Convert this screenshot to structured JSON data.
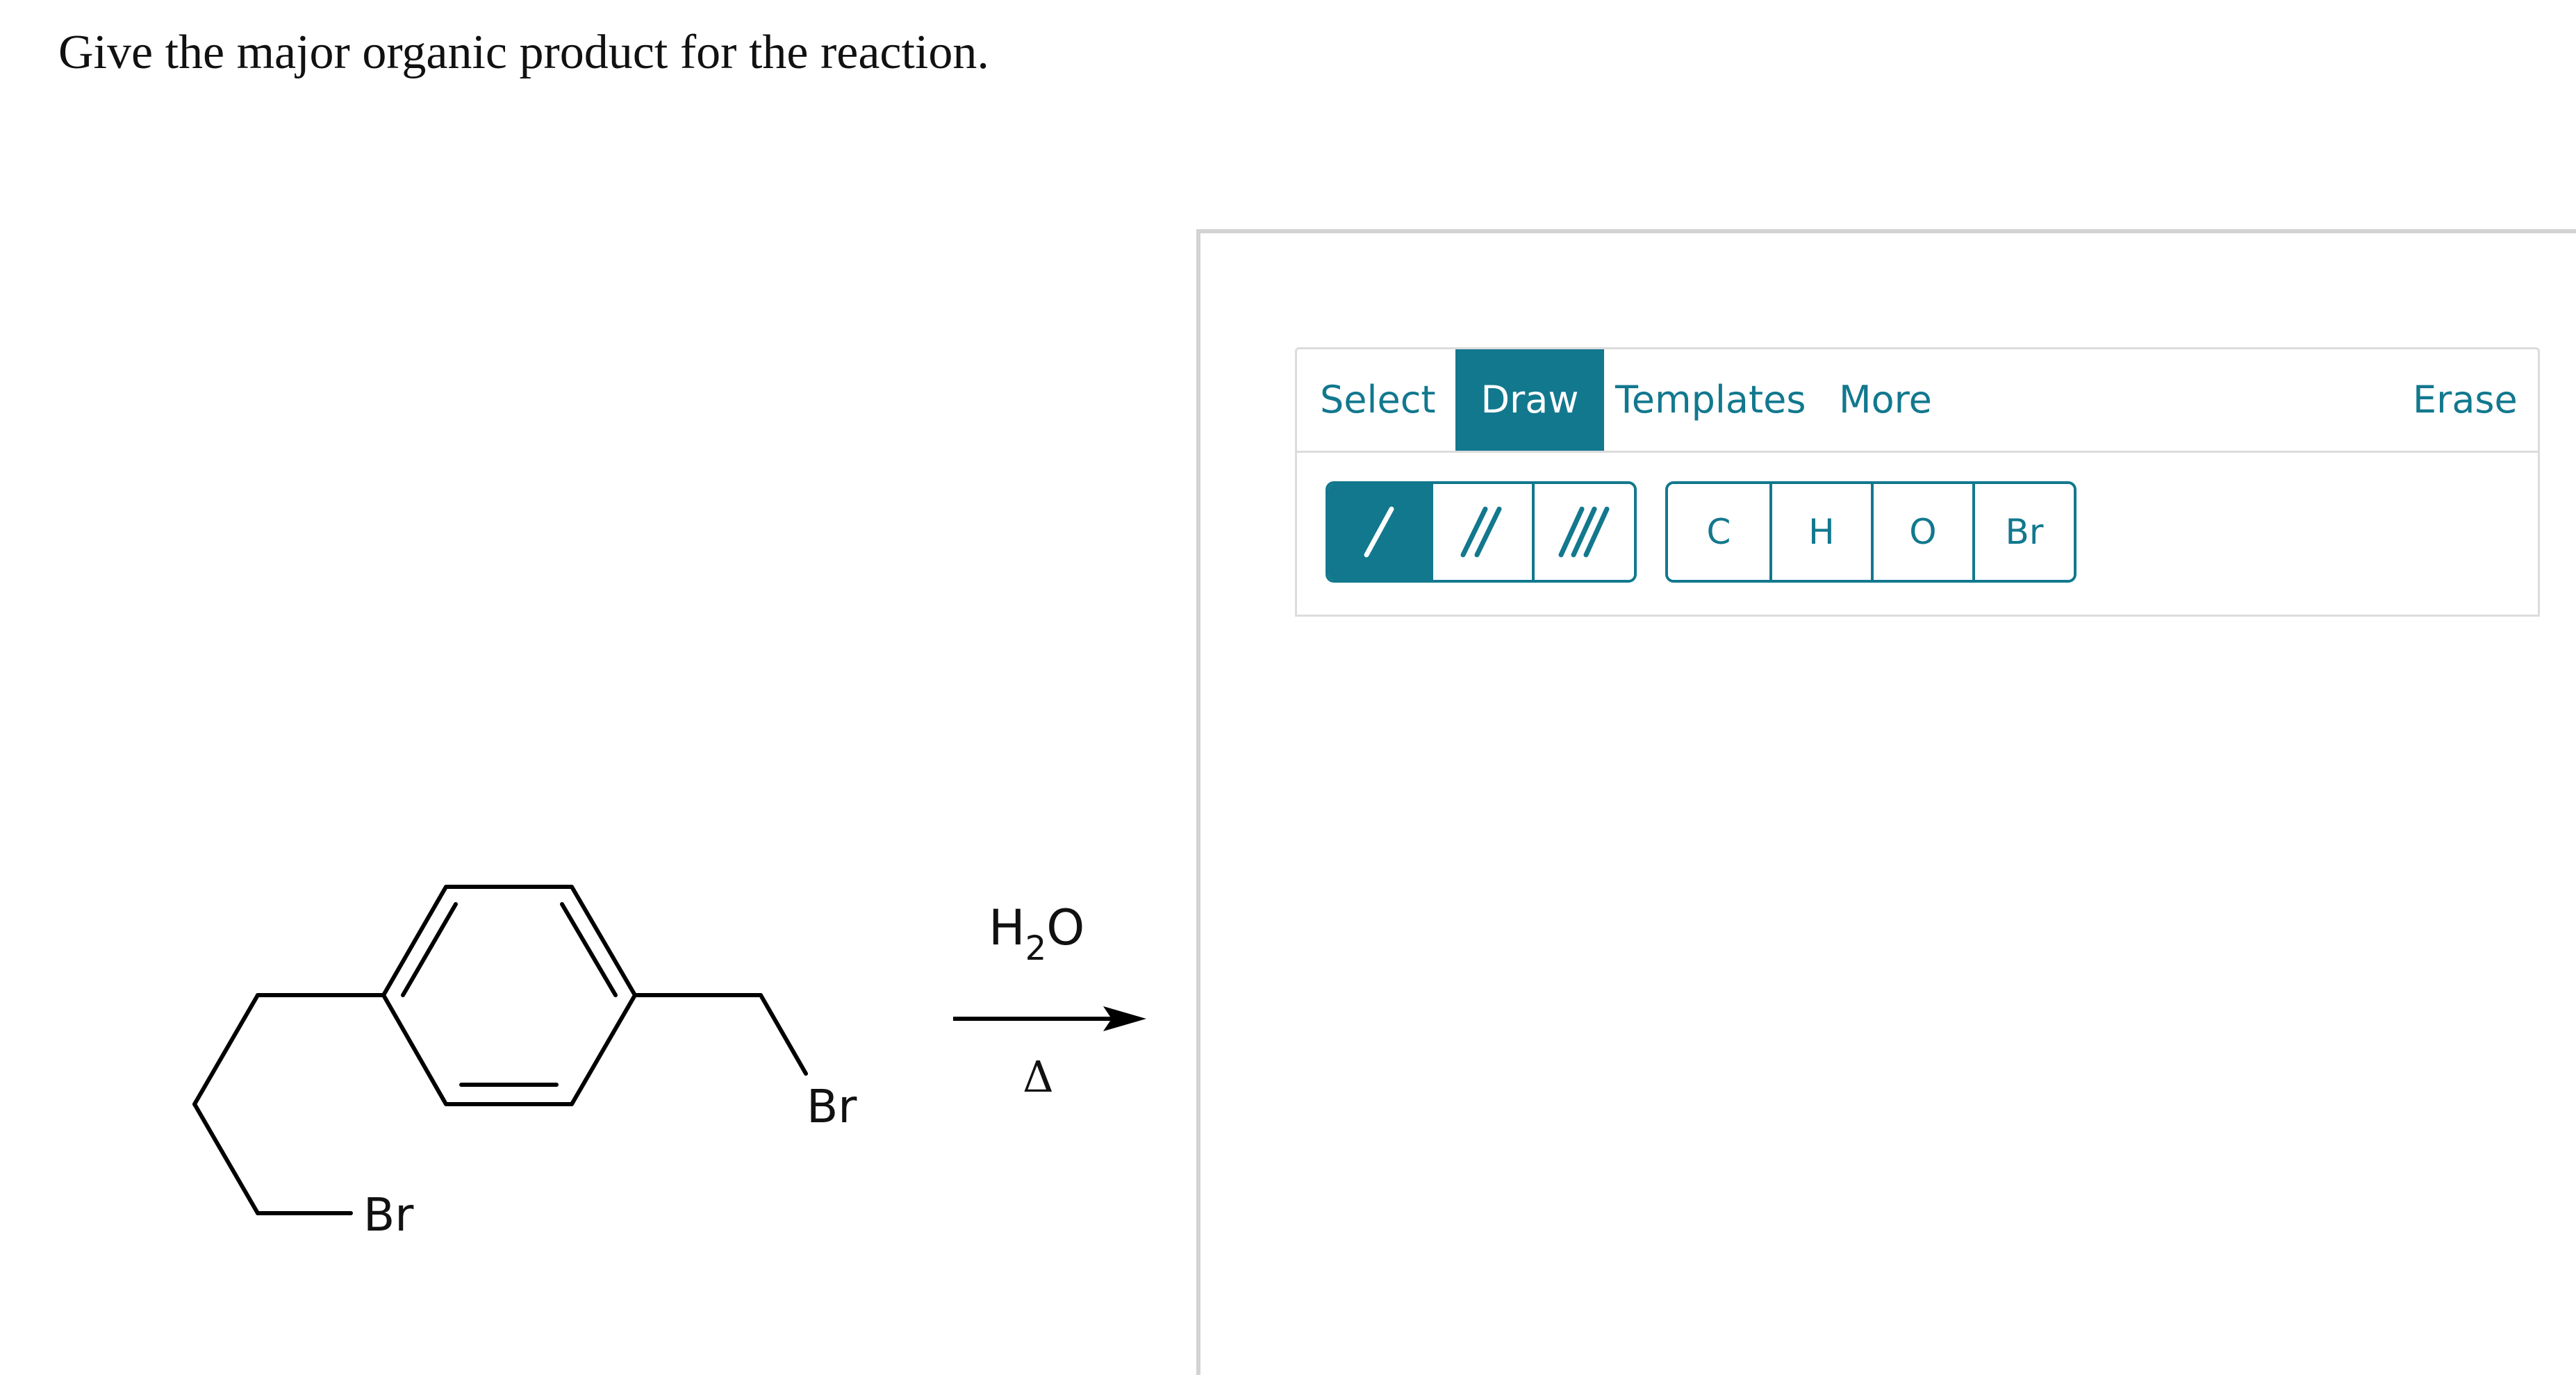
{
  "question": {
    "text": "Give the major organic product for the reaction."
  },
  "reaction": {
    "substituent_left": "Br",
    "substituent_right": "Br",
    "reagent_main": "H",
    "reagent_sub": "2",
    "reagent_end": "O",
    "condition": "Δ"
  },
  "toolbar": {
    "tabs": [
      {
        "label": "Select"
      },
      {
        "label": "Draw",
        "active": true
      },
      {
        "label": "Templates"
      },
      {
        "label": "More"
      }
    ],
    "erase_label": "Erase",
    "bond_tools": [
      {
        "icon": "single-bond-icon",
        "active": true
      },
      {
        "icon": "double-bond-icon"
      },
      {
        "icon": "triple-bond-icon"
      }
    ],
    "atoms": [
      "C",
      "H",
      "O",
      "Br"
    ]
  },
  "colors": {
    "accent": "#12788e",
    "border": "#dcdcdc",
    "panel_border": "#d3d3d3"
  }
}
